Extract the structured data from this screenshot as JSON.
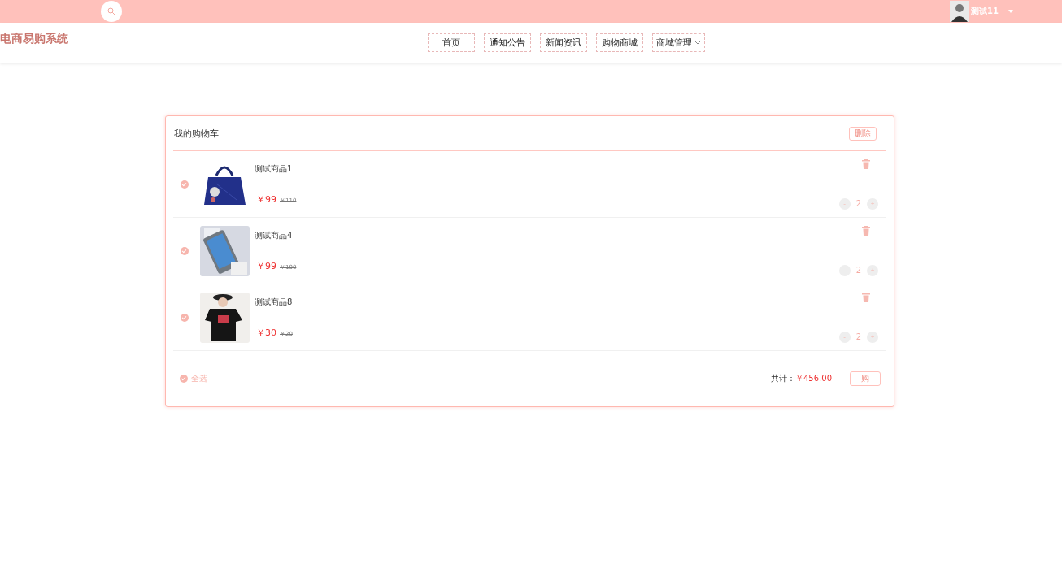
{
  "top_bar": {
    "user": {
      "name": "测试11"
    }
  },
  "header": {
    "logo": "电商易购系统",
    "nav": [
      {
        "label": "首页",
        "dropdown": false
      },
      {
        "label": "通知公告",
        "dropdown": false
      },
      {
        "label": "新闻资讯",
        "dropdown": false
      },
      {
        "label": "购物商城",
        "dropdown": false
      },
      {
        "label": "商城管理",
        "dropdown": true
      }
    ]
  },
  "cart": {
    "title": "我的购物车",
    "delete_button": "删除",
    "items": [
      {
        "name": "测试商品1",
        "price": "￥99",
        "original_price": "￥110",
        "quantity": "2",
        "minus": "-",
        "plus": "+",
        "checked": true,
        "kind": "picture"
      },
      {
        "name": "测试商品4",
        "price": "￥99",
        "original_price": "￥100",
        "quantity": "2",
        "minus": "-",
        "plus": "+",
        "checked": true,
        "kind": "picture"
      },
      {
        "name": "测试商品8",
        "price": "￥30",
        "original_price": "￥20",
        "quantity": "2",
        "minus": "-",
        "plus": "+",
        "checked": true,
        "kind": "picture"
      }
    ],
    "footer": {
      "select_all": {
        "label": "全选",
        "checked": true
      },
      "total_label": "共计：",
      "total": "￥456.00",
      "checkout_button": "购"
    }
  }
}
